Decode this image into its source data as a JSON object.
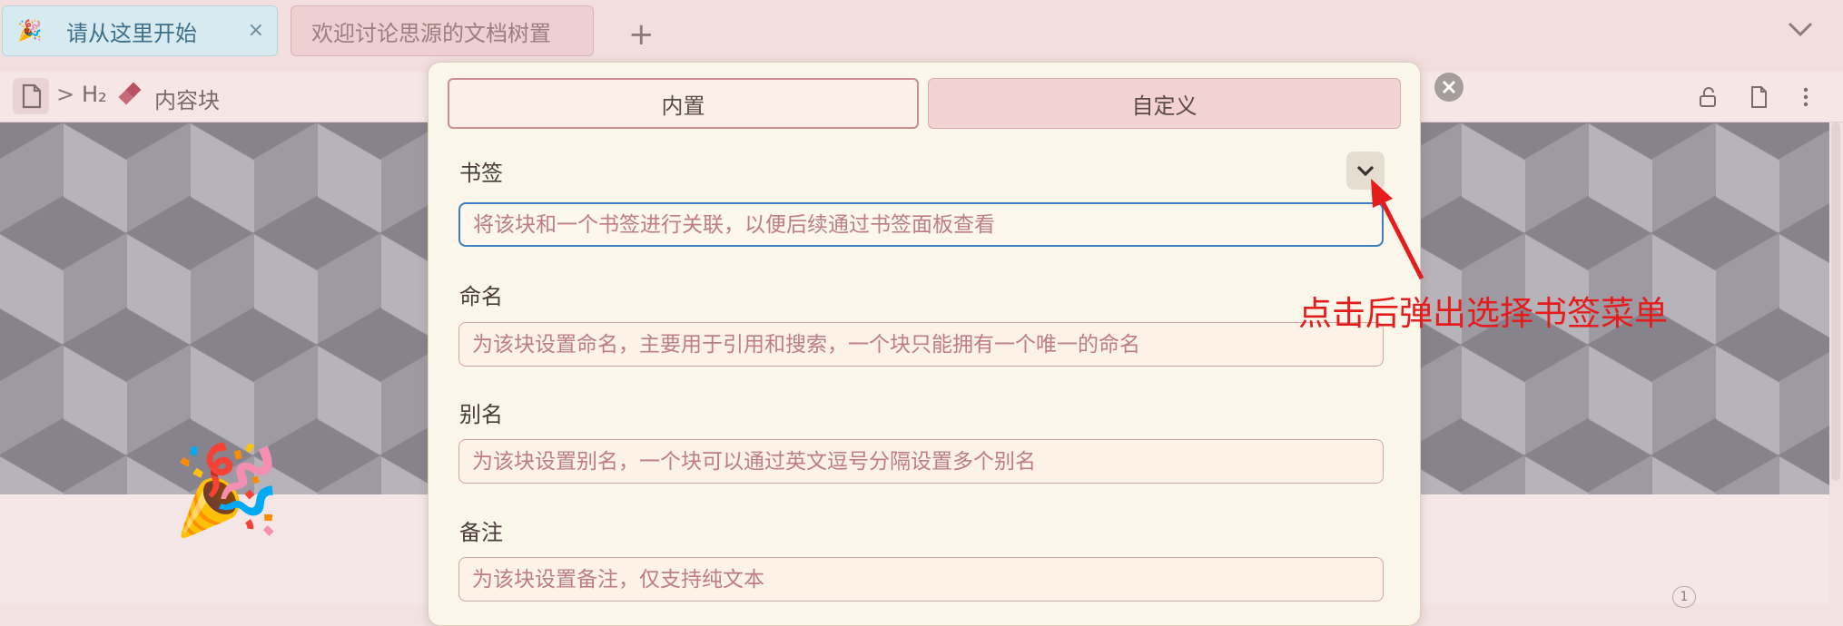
{
  "tabs": [
    {
      "emoji": "🎉",
      "label": "请从这里开始",
      "close": "×"
    },
    {
      "label": "欢迎讨论思源的文档树置"
    }
  ],
  "new_tab": "+",
  "breadcrumb": {
    "separator": ">",
    "heading": "H₂",
    "label": "内容块"
  },
  "panel": {
    "segments": {
      "builtin": "内置",
      "custom": "自定义"
    },
    "fields": {
      "bookmark": {
        "label": "书签",
        "placeholder": "将该块和一个书签进行关联，以便后续通过书签面板查看"
      },
      "name": {
        "label": "命名",
        "placeholder": "为该块设置命名，主要用于引用和搜索，一个块只能拥有一个唯一的命名"
      },
      "alias": {
        "label": "别名",
        "placeholder": "为该块设置别名，一个块可以通过英文逗号分隔设置多个别名"
      },
      "memo": {
        "label": "备注",
        "placeholder": "为该块设置备注，仅支持纯文本"
      }
    }
  },
  "annotation": {
    "text": "点击后弹出选择书签菜单",
    "color": "#e51c1c"
  },
  "page_icon_emoji": "🎉",
  "pager": "1",
  "colors": {
    "accent_focus": "#3b7fc2",
    "annotation": "#e51c1c"
  }
}
